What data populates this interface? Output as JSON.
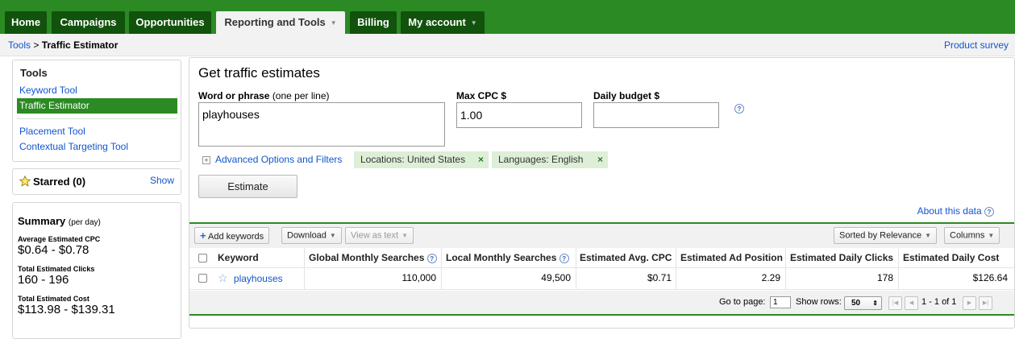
{
  "nav": {
    "tabs": [
      {
        "label": "Home"
      },
      {
        "label": "Campaigns"
      },
      {
        "label": "Opportunities"
      },
      {
        "label": "Reporting and Tools"
      },
      {
        "label": "Billing"
      },
      {
        "label": "My account"
      }
    ]
  },
  "breadcrumb": {
    "parent": "Tools",
    "separator": ">",
    "current": "Traffic Estimator",
    "survey": "Product survey"
  },
  "sidebar": {
    "tools_title": "Tools",
    "links": [
      "Keyword Tool",
      "Traffic Estimator",
      "Placement Tool",
      "Contextual Targeting Tool"
    ],
    "starred_label": "Starred (0)",
    "show_label": "Show",
    "summary": {
      "title": "Summary",
      "period": "(per day)",
      "items": [
        {
          "label": "Average Estimated CPC",
          "value": "$0.64 - $0.78"
        },
        {
          "label": "Total Estimated Clicks",
          "value": "160 - 196"
        },
        {
          "label": "Total Estimated Cost",
          "value": "$113.98 - $139.31"
        }
      ]
    }
  },
  "form": {
    "title": "Get traffic estimates",
    "phrase_label": "Word or phrase",
    "phrase_hint": "(one per line)",
    "phrase_value": "playhouses",
    "cpc_label": "Max CPC $",
    "cpc_value": "1.00",
    "budget_label": "Daily budget $",
    "budget_value": "",
    "help": "?",
    "advanced": "Advanced Options and Filters",
    "chips": [
      "Locations: United States",
      "Languages: English"
    ],
    "chip_remove": "×",
    "estimate": "Estimate",
    "about": "About this data"
  },
  "toolbar": {
    "add_keywords": "Add keywords",
    "download": "Download",
    "view_as_text": "View as text",
    "sorted": "Sorted by Relevance",
    "columns": "Columns"
  },
  "table": {
    "headers": [
      "Keyword",
      "Global Monthly Searches",
      "Local Monthly Searches",
      "Estimated Avg. CPC",
      "Estimated Ad Position",
      "Estimated Daily Clicks",
      "Estimated Daily Cost"
    ],
    "rows": [
      {
        "keyword": "playhouses",
        "global": "110,000",
        "local": "49,500",
        "cpc": "$0.71",
        "position": "2.29",
        "clicks": "178",
        "cost": "$126.64"
      }
    ]
  },
  "pager": {
    "go_to_label": "Go to page:",
    "page_value": "1",
    "show_rows_label": "Show rows:",
    "rows_value": "50",
    "range": "1 - 1 of 1"
  },
  "colors": {
    "brand_green": "#2b8a23",
    "dark_tab": "#11520c",
    "link_blue": "#1155cc"
  }
}
